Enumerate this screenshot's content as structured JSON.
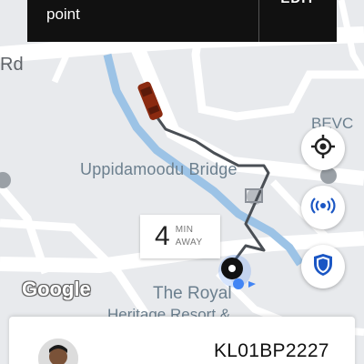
{
  "header": {
    "text": "point",
    "action_label": "EDIT"
  },
  "map": {
    "labels": {
      "road": "Rd",
      "bridge": "Uppidamoodu Bridge",
      "building": "BEVC",
      "poi_line1": "The Royal",
      "poi_line2": "Heritage Resort &"
    },
    "attribution": "Google"
  },
  "eta": {
    "value": "4",
    "unit_top": "MIN",
    "unit_bottom": "AWAY"
  },
  "buttons": {
    "locate_icon": "crosshair-icon",
    "signal_icon": "signal-broadcast-icon",
    "safety_icon": "shield-icon"
  },
  "driver": {
    "plate": "KL01BP2227"
  },
  "colors": {
    "route": "#4a4f55",
    "river": "#9cc3e6",
    "car": "#8b2a10",
    "shield": "#1a56c4",
    "signal": "#1a56c4",
    "rider_dot": "#4285f4"
  }
}
